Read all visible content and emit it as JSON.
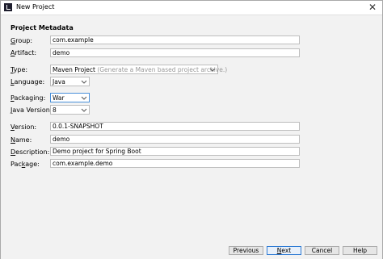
{
  "window": {
    "title": "New Project",
    "close_glyph": "✕"
  },
  "section": {
    "heading": "Project Metadata"
  },
  "fields": {
    "group": {
      "mnemonic": "G",
      "label_rest": "roup:",
      "value": "com.example"
    },
    "artifact": {
      "mnemonic": "A",
      "label_rest": "rtifact:",
      "value": "demo"
    },
    "type": {
      "mnemonic": "T",
      "label_rest": "ype:",
      "value": "Maven Project",
      "hint": "(Generate a Maven based project archive.)"
    },
    "language": {
      "mnemonic": "L",
      "label_rest": "anguage:",
      "value": "Java"
    },
    "packaging": {
      "mnemonic": "P",
      "label_rest": "ackaging:",
      "value": "War"
    },
    "java_version": {
      "mnemonic": "J",
      "label_rest": "ava Version:",
      "value": "8"
    },
    "version": {
      "mnemonic": "V",
      "label_rest": "ersion:",
      "value": "0.0.1-SNAPSHOT"
    },
    "name": {
      "mnemonic": "N",
      "label_rest": "ame:",
      "value": "demo"
    },
    "description": {
      "mnemonic": "D",
      "label_rest": "escription:",
      "value": "Demo project for Spring Boot"
    },
    "package": {
      "label_pre": "Pac",
      "mnemonic": "k",
      "label_rest": "age:",
      "value": "com.example.demo"
    }
  },
  "buttons": {
    "previous": {
      "label": "Previous"
    },
    "next": {
      "mnemonic": "N",
      "label_rest": "ext"
    },
    "cancel": {
      "label": "Cancel"
    },
    "help": {
      "label": "Help"
    }
  },
  "colors": {
    "focus": "#4a90d9",
    "primary_border": "#2f7bd4",
    "panel": "#f2f2f2"
  }
}
